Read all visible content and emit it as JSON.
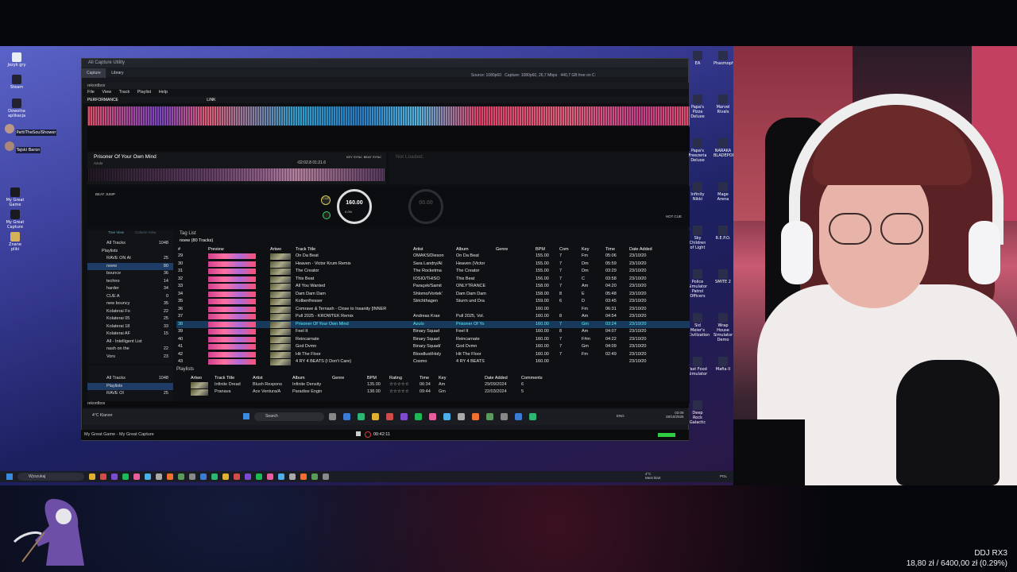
{
  "desktop": {
    "icons": [
      "Jezyk gry",
      "Steam",
      "Dowolna aplikacja",
      "PattiTheSoulShower",
      "Tajski Baron",
      "My Great Game",
      "My Great Capture",
      "Znane pliki"
    ],
    "right_icons": [
      "EA",
      "Papa's Pizza Deluxe",
      "Papa's Freezeria Deluxe",
      "Infinity Nikki",
      "Sky Children of Light",
      "Police Simulator Patrol Officers",
      "Sid Meier's Civilization",
      "Fast Food Simulator",
      "Deep Rock Galactic",
      "Phasmophobia",
      "Marvel Rivals",
      "NARAKA BLADEPOINT",
      "Mage Arena",
      "R.E.P.O.",
      "SMITE 2",
      "Wrap House Simulator Demo",
      "Mafia II"
    ]
  },
  "capture_window": {
    "title": "All Capture Utility",
    "tabs": [
      "Capture",
      "Library"
    ],
    "source": "Source: 1080p60",
    "capture_info": "Capture: 1080p60, 26,7 Mbps",
    "free_space": "440,7 GB free on C:",
    "footer_name": "My Great Game - My Great Capture",
    "record_time": "00:42:11"
  },
  "rekordbox": {
    "app_title": "rekordbox",
    "menu": [
      "File",
      "View",
      "Track",
      "Playlist",
      "Help"
    ],
    "mode": "PERFORMANCE",
    "link": "LINK",
    "deck1": {
      "title": "Prisoner Of Your Own Mind",
      "artist": "Azulo",
      "bpm_small": "160.00 Gm",
      "time": "-02:02.8",
      "time2": "01:21.6",
      "tempo": "160.00",
      "pitch": "0.0%",
      "key_sync": "KEY SYNC",
      "beat_sync": "BEAT SYNC",
      "master": "MASTER",
      "beat_jump": "BEAT JUMP",
      "cue": "CUE"
    },
    "deck2": {
      "title": "Not Loaded.",
      "tempo": "00.00",
      "hot_cue": "HOT CUE"
    },
    "browser": {
      "tag_list": "Tag List",
      "list_title": "noew (80 Tracks)",
      "tree_view": "Tree View",
      "column_view": "Column View",
      "tree": [
        {
          "label": "All Tracks",
          "count": "1048"
        },
        {
          "label": "Playlists",
          "count": ""
        },
        {
          "label": "RAVE ON AI",
          "count": "25"
        },
        {
          "label": "noew",
          "count": "80"
        },
        {
          "label": "bounce",
          "count": "36"
        },
        {
          "label": "techno",
          "count": "14"
        },
        {
          "label": "harder",
          "count": "34"
        },
        {
          "label": "CUE A",
          "count": "0"
        },
        {
          "label": "new bouncy",
          "count": "35"
        },
        {
          "label": "Kolaterai Fo",
          "count": "22"
        },
        {
          "label": "Kolaterai 05",
          "count": "25"
        },
        {
          "label": "Kolaterai 18",
          "count": "33"
        },
        {
          "label": "Kolaterai AF",
          "count": "15"
        },
        {
          "label": "All - Intelligent List",
          "count": ""
        },
        {
          "label": "nash on the",
          "count": "22"
        },
        {
          "label": "Vors",
          "count": "23"
        }
      ],
      "columns": [
        "#",
        "Preview",
        "Artwo",
        "Track Title",
        "Artist",
        "Album",
        "Genre",
        "BPM",
        "Com",
        "Key",
        "Time",
        "Date Added"
      ],
      "rows": [
        [
          "29",
          "On Da Beat",
          "OMAKS/Dieson",
          "On Da Beat",
          "155.00",
          "7",
          "Fm",
          "05:06",
          "23/10/20"
        ],
        [
          "30",
          "Heaven - Victor Krum Remix",
          "Sara Landry/AI",
          "Heaven (Victor",
          "155.00",
          "7",
          "Dm",
          "05:59",
          "23/10/20"
        ],
        [
          "31",
          "The Creator",
          "The Rocketma",
          "The Creator",
          "155.00",
          "7",
          "Dm",
          "03:29",
          "23/10/20"
        ],
        [
          "32",
          "This Beat",
          "IOSIO/THISO",
          "This Beat",
          "156.00",
          "7",
          "C",
          "03:58",
          "23/10/20"
        ],
        [
          "33",
          "All You Wanted",
          "Paraçek/Samit",
          "ONLYTRANCE",
          "158.00",
          "7",
          "Am",
          "04:20",
          "23/10/20"
        ],
        [
          "34",
          "Dam Dam Dam",
          "Shlomo/Vortek'",
          "Dam Dam Dam",
          "158.00",
          "8",
          "E",
          "05:48",
          "23/10/20"
        ],
        [
          "35",
          "Kolbenfresser",
          "Strichthagen",
          "Sturm und Dra",
          "159.00",
          "6",
          "D",
          "03:45",
          "23/10/20"
        ],
        [
          "36",
          "Comrave & Ternash - Close to Insanity [INNER",
          "",
          "",
          "160.00",
          "",
          "Fm",
          "06:31",
          "23/10/20"
        ],
        [
          "37",
          "Pull 2025 - KROWTEK Remix",
          "Andreas Krae",
          "Pull 2025, Vol.",
          "160.00",
          "8",
          "Am",
          "04:54",
          "23/10/20"
        ],
        [
          "38",
          "Prisoner Of Your Own Mind",
          "Azulo",
          "Prisoner Of Yo",
          "160.00",
          "7",
          "Gm",
          "03:24",
          "23/10/20"
        ],
        [
          "39",
          "Feel It",
          "Binary Squad",
          "Feel It",
          "160.00",
          "8",
          "Am",
          "04:07",
          "23/10/20"
        ],
        [
          "40",
          "Reincarnate",
          "Binary Squad",
          "Reincarnate",
          "160.00",
          "7",
          "F#m",
          "04:22",
          "23/10/20"
        ],
        [
          "41",
          "God Dvmn",
          "Binary Squad/",
          "God Dvmn",
          "160.00",
          "7",
          "Gm",
          "04:09",
          "23/10/20"
        ],
        [
          "42",
          "Hit The Floor",
          "Bloodlust/Holy",
          "Hit The Floor",
          "160.00",
          "7",
          "Fm",
          "02:49",
          "23/10/20"
        ],
        [
          "43",
          "4 RY 4 BEATS (I Don't Care)",
          "Cosmo",
          "4 RY 4 BEATS",
          "160.00",
          "",
          "",
          "",
          "23/10/20"
        ]
      ],
      "highlight_index": 9
    },
    "lower": {
      "tree": [
        {
          "label": "All Tracks",
          "count": "1048"
        },
        {
          "label": "Playlists",
          "count": ""
        },
        {
          "label": "RAVE OI",
          "count": "25"
        }
      ],
      "playlists_label": "Playlists",
      "columns": [
        "Artwo",
        "Track Title",
        "Artist",
        "Album",
        "Genre",
        "BPM",
        "Rating",
        "Time",
        "Key",
        "Date Added",
        "Comments"
      ],
      "rows": [
        [
          "Infinite Dread",
          "Blush Respons",
          "Infinite Density",
          "135.00",
          "☆☆☆☆☆",
          "06:34",
          "Am",
          "29/09/2024",
          "6"
        ],
        [
          "Pranava",
          "Ace Ventura/A",
          "Paradise Engin",
          "138.00",
          "☆☆☆☆☆",
          "09:44",
          "Gm",
          "22/03/2024",
          "5"
        ]
      ]
    },
    "footer": "rekordbox"
  },
  "inner_taskbar": {
    "weather": "4°C Klarver",
    "search": "Search",
    "lang": "ENG",
    "time": "03:09",
    "date": "28/10/2025"
  },
  "outer_taskbar": {
    "search": "Wyszukaj",
    "weather_temp": "4°C",
    "weather_desc": "Mest klart",
    "lang": "POL"
  },
  "ticker": {
    "name": "DDJ RX3",
    "progress_text": "18,80 zł / 6400,00 zł (0.29%)",
    "progress_fraction": 0.0029
  },
  "colors": {
    "highlight_row": "#173a5c",
    "highlight_text": "#5ff0ff",
    "accent_blue": "#1f6fd8"
  }
}
